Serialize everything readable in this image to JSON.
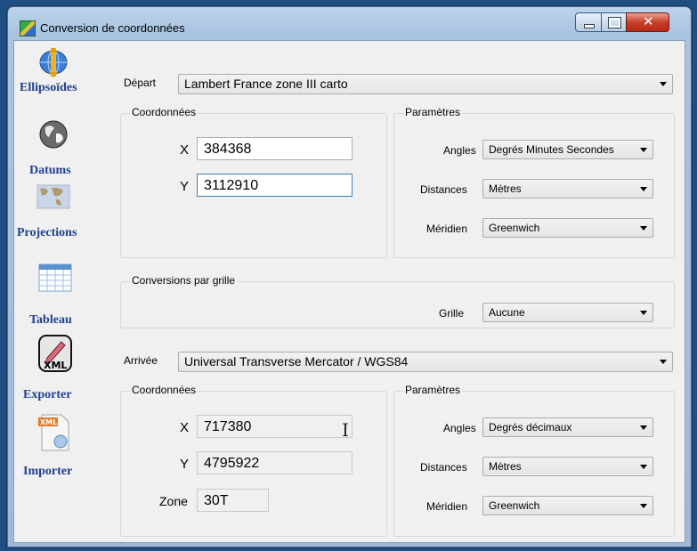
{
  "window": {
    "title": "Conversion de coordonnées"
  },
  "sidebar": {
    "items": [
      {
        "label": "Ellipsoïdes",
        "icon": "globe-ellipsoid-icon"
      },
      {
        "label": "Datums",
        "icon": "globe-datum-icon"
      },
      {
        "label": "Projections",
        "icon": "map-projection-icon"
      },
      {
        "label": "Tableau",
        "icon": "table-icon"
      },
      {
        "label": "Exporter",
        "icon": "xml-export-icon"
      },
      {
        "label": "Importer",
        "icon": "xml-import-icon"
      }
    ]
  },
  "depart": {
    "label": "Départ",
    "selected": "Lambert France zone III carto",
    "coords": {
      "title": "Coordonnées",
      "x_label": "X",
      "x_value": "384368",
      "y_label": "Y",
      "y_value": "3112910"
    },
    "params": {
      "title": "Paramètres",
      "angles_label": "Angles",
      "angles_value": "Degrés Minutes Secondes",
      "distances_label": "Distances",
      "distances_value": "Mètres",
      "meridien_label": "Méridien",
      "meridien_value": "Greenwich"
    }
  },
  "grille": {
    "title": "Conversions par grille",
    "label": "Grille",
    "value": "Aucune"
  },
  "arrivee": {
    "label": "Arrivée",
    "selected": "Universal Transverse Mercator / WGS84",
    "coords": {
      "title": "Coordonnées",
      "x_label": "X",
      "x_value": "717380",
      "y_label": "Y",
      "y_value": "4795922",
      "zone_label": "Zone",
      "zone_value": "30T"
    },
    "params": {
      "title": "Paramètres",
      "angles_label": "Angles",
      "angles_value": "Degrés décimaux",
      "distances_label": "Distances",
      "distances_value": "Mètres",
      "meridien_label": "Méridien",
      "meridien_value": "Greenwich"
    }
  },
  "colors": {
    "sidebar_label": "#1f3f8f",
    "title_bar": "#a9c4e1",
    "close_button": "#c8402a"
  }
}
